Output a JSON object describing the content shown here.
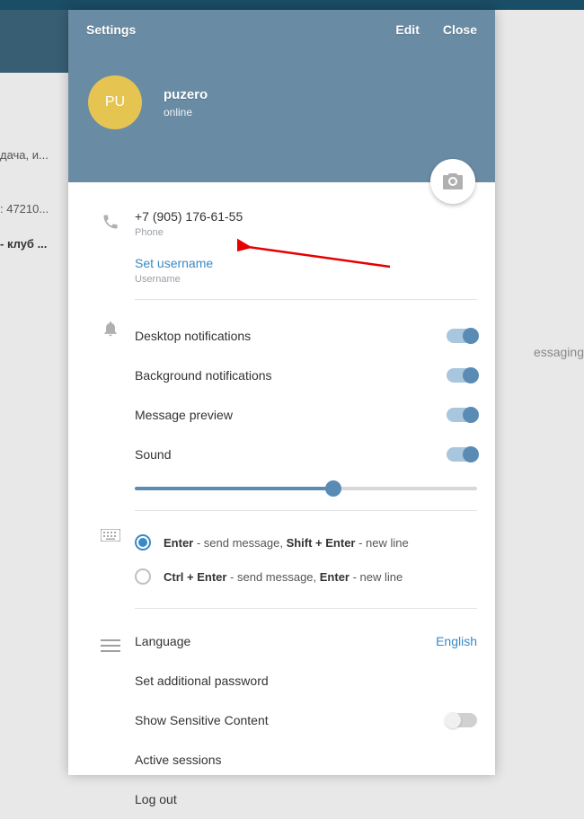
{
  "header": {
    "title": "Settings",
    "edit": "Edit",
    "close": "Close"
  },
  "profile": {
    "initials": "PU",
    "name": "puzero",
    "status": "online"
  },
  "phone": {
    "value": "+7 (905) 176-61-55",
    "label": "Phone"
  },
  "username": {
    "action": "Set username",
    "label": "Username"
  },
  "notifications": {
    "desktop": "Desktop notifications",
    "background": "Background notifications",
    "preview": "Message preview",
    "sound": "Sound"
  },
  "sendKey": {
    "opt1_b1": "Enter",
    "opt1_mid": " - send message, ",
    "opt1_b2": "Shift + Enter",
    "opt1_end": " - new line",
    "opt2_b1": "Ctrl + Enter",
    "opt2_mid": " - send message, ",
    "opt2_b2": "Enter",
    "opt2_end": " - new line"
  },
  "general": {
    "language_label": "Language",
    "language_value": "English",
    "password": "Set additional password",
    "sensitive": "Show Sensitive Content",
    "sessions": "Active sessions",
    "logout": "Log out"
  },
  "background": {
    "side1": "дача, и...",
    "side2": ": 47210...",
    "side3": "- клуб ...",
    "right": "essaging"
  }
}
